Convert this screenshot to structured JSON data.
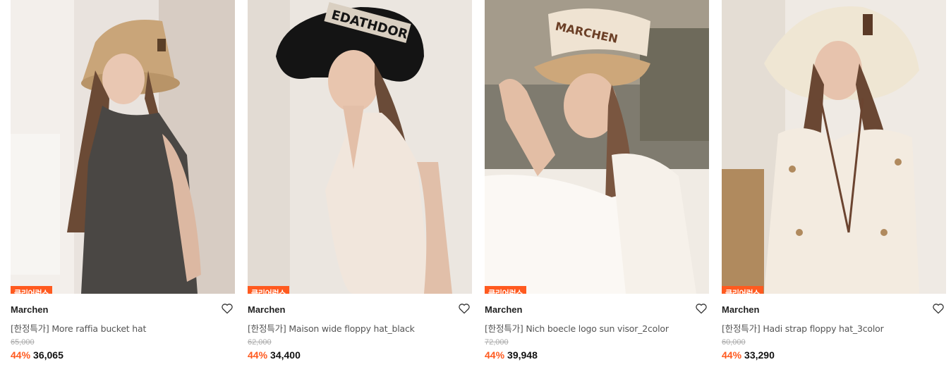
{
  "products": [
    {
      "badge": "클리어런스",
      "brand": "Marchen",
      "name": "[한정특가] More raffia bucket hat",
      "original_price": "65,000",
      "discount": "44%",
      "price": "36,065",
      "wishlist_icon": "heart-outline-icon",
      "image_icon": "product-photo-raffia-bucket-hat"
    },
    {
      "badge": "클리어런스",
      "brand": "Marchen",
      "name": "[한정특가] Maison wide floppy hat_black",
      "original_price": "62,000",
      "discount": "44%",
      "price": "34,400",
      "wishlist_icon": "heart-outline-icon",
      "image_icon": "product-photo-black-visor-hat"
    },
    {
      "badge": "클리어런스",
      "brand": "Marchen",
      "name": "[한정특가] Nich boecle logo sun visor_2color",
      "original_price": "72,000",
      "discount": "44%",
      "price": "39,948",
      "wishlist_icon": "heart-outline-icon",
      "image_icon": "product-photo-straw-sun-visor"
    },
    {
      "badge": "클리어런스",
      "brand": "Marchen",
      "name": "[한정특가] Hadi strap floppy hat_3color",
      "original_price": "60,000",
      "discount": "44%",
      "price": "33,290",
      "wishlist_icon": "heart-outline-icon",
      "image_icon": "product-photo-strap-floppy-hat"
    }
  ],
  "colors": {
    "accent": "#ff5a1f",
    "text": "#222222",
    "muted": "#555555",
    "strike": "#aaaaaa"
  }
}
